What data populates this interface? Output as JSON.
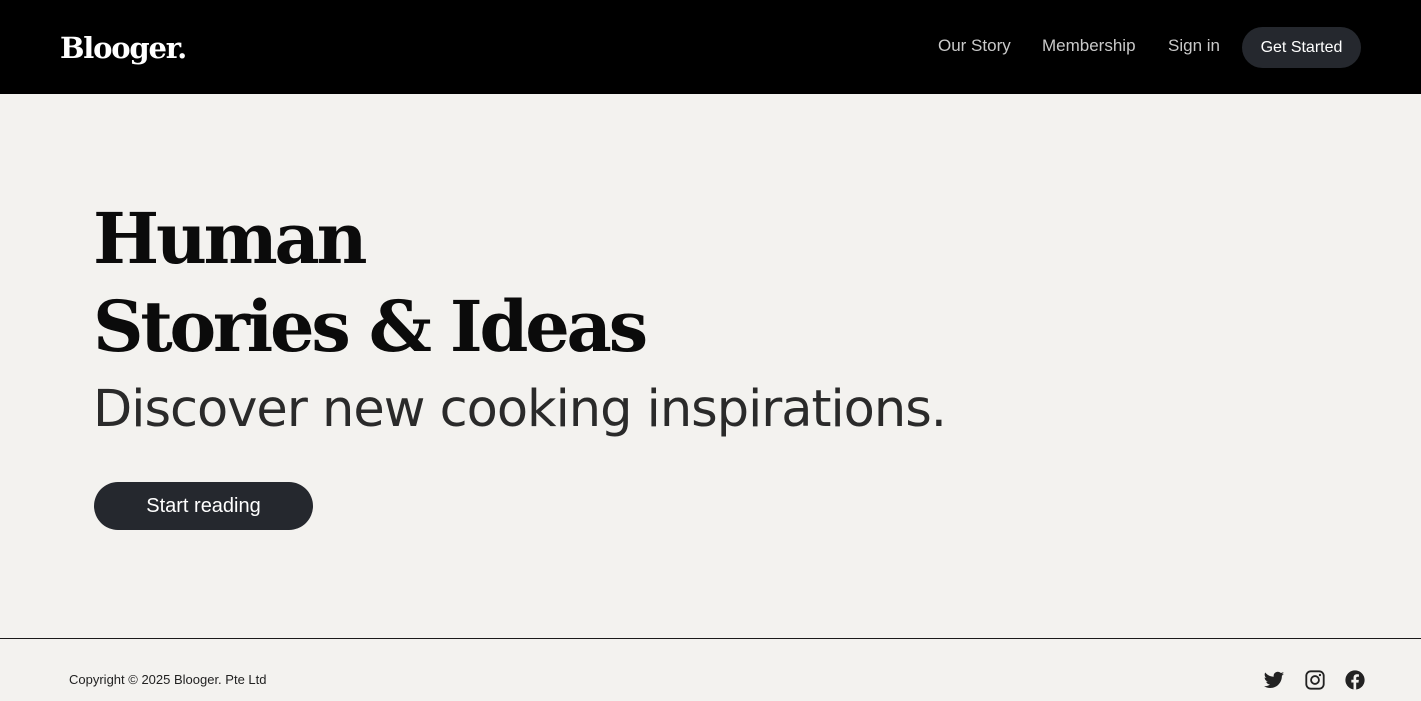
{
  "header": {
    "logo": "Blooger.",
    "nav": {
      "our_story": "Our Story",
      "membership": "Membership",
      "sign_in": "Sign in"
    },
    "cta": "Get Started"
  },
  "hero": {
    "title_line1": "Human",
    "title_line2": "Stories & Ideas",
    "subtitle": "Discover new cooking inspirations.",
    "cta": "Start reading"
  },
  "footer": {
    "copyright": "Copyright © 2025 Blooger. Pte Ltd",
    "social_icons": [
      "twitter-icon",
      "instagram-icon",
      "facebook-icon"
    ]
  },
  "colors": {
    "header_bg": "#000000",
    "page_bg": "#f3f2ef",
    "button_bg": "#25282e",
    "nav_text": "#c9c9c9"
  }
}
